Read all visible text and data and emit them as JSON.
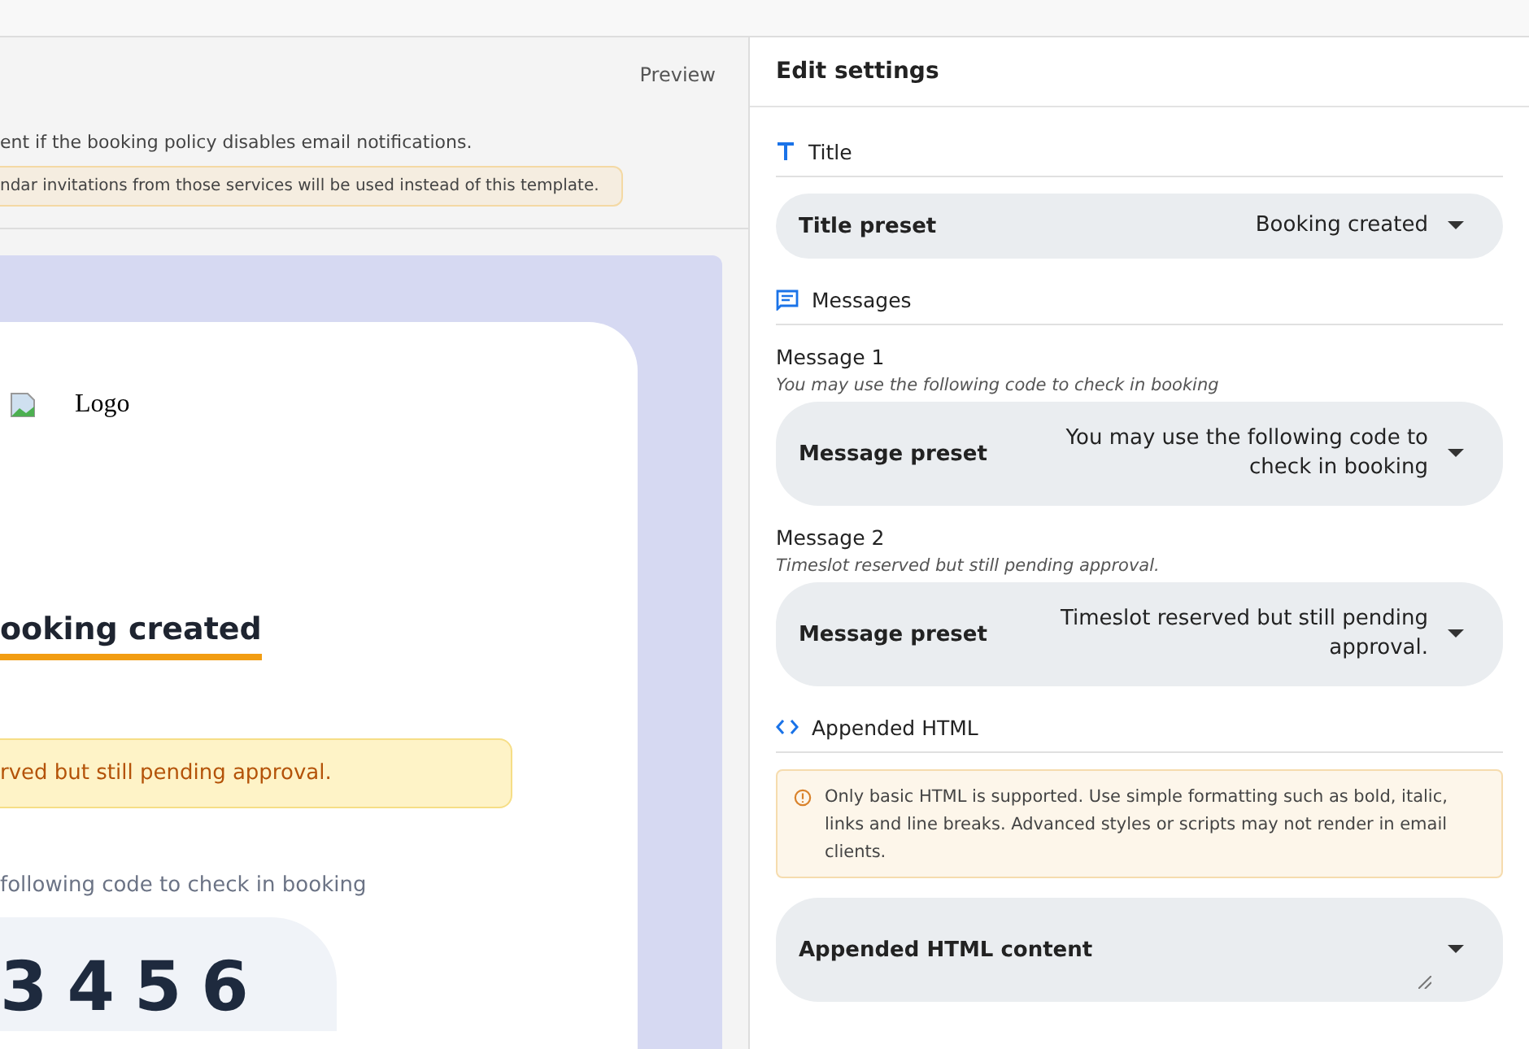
{
  "preview_pane": {
    "label": "Preview",
    "notice": "ent if the booking policy disables email notifications.",
    "warning": "ndar invitations from those services will be used instead of this template.",
    "email": {
      "logo": "Logo",
      "heading": "ooking created",
      "alert": "rved but still pending approval.",
      "message": "following code to check in booking",
      "code": "3456"
    }
  },
  "settings": {
    "title": "Edit settings",
    "sections": [
      {
        "kind": "title",
        "heading": "Title",
        "fields": [
          {
            "label": "Title preset",
            "value": "Booking created"
          }
        ]
      },
      {
        "kind": "messages",
        "heading": "Messages",
        "fields": [
          {
            "caption": "Message 1",
            "hint": "You may use the following code to check in booking",
            "label": "Message preset",
            "value": "You may use the following code to check in booking"
          },
          {
            "caption": "Message 2",
            "hint": "Timeslot reserved but still pending approval.",
            "label": "Message preset",
            "value": "Timeslot reserved but still pending approval."
          }
        ]
      },
      {
        "kind": "html",
        "heading": "Appended HTML",
        "note": "Only basic HTML is supported. Use simple formatting such as bold, italic, links and line breaks. Advanced styles or scripts may not render in email clients.",
        "fields": [
          {
            "label": "Appended HTML content"
          }
        ]
      }
    ]
  }
}
